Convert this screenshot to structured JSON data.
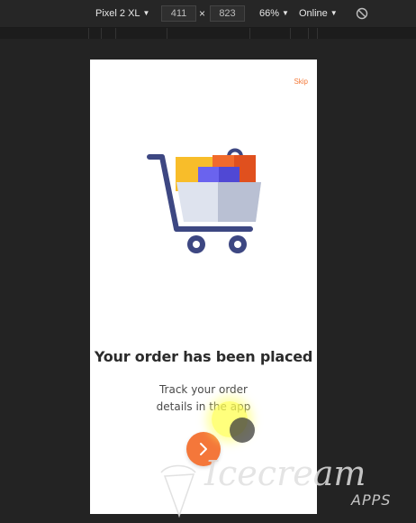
{
  "devtools": {
    "device": "Pixel 2 XL",
    "width": "411",
    "times": "×",
    "height": "823",
    "zoom": "66%",
    "network": "Online",
    "rotate_icon": "no-sign-icon"
  },
  "screen": {
    "skip_label": "Skip",
    "illustration_icon": "shopping-cart-icon",
    "title": "Your order has been placed",
    "subtitle_line1": "Track your order",
    "subtitle_line2": "details in the app",
    "next_icon": "chevron-right-icon",
    "accent": "#f4773a"
  },
  "watermark": {
    "brand": "Icecream",
    "sub": "APPS"
  }
}
